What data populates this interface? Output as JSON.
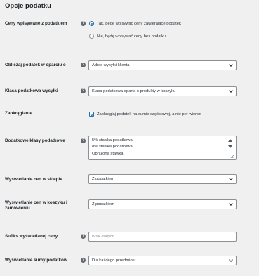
{
  "page": {
    "title": "Opcje podatku"
  },
  "prices_entered": {
    "label": "Ceny wpisywane z podatkiem",
    "options": [
      {
        "label": "Tak, będę wpisywać ceny zawierające podatek",
        "selected": true
      },
      {
        "label": "Nie, będę wpisywać ceny bez podatku",
        "selected": false
      }
    ]
  },
  "tax_based_on": {
    "label": "Obliczaj podatek w oparciu o",
    "value": "Adres wysyłki klienta"
  },
  "shipping_tax_class": {
    "label": "Klasa podatkowa wysyłki",
    "value": "Klasa podatkowa oparta o produkty w koszyku"
  },
  "rounding": {
    "label": "Zaokrąglanie",
    "checkbox_label": "Zaokrąglaj podatek na sumie częściowej, a nie per wiersz",
    "checked": true
  },
  "additional_tax_classes": {
    "label": "Dodatkowe klasy podatkowe",
    "items": [
      "5% stawka podatkowa",
      "8% stawka podatkowa",
      "Obniżona stawka"
    ]
  },
  "display_shop": {
    "label": "Wyświetlanie cen w sklepie",
    "value": "Z podatkiem"
  },
  "display_cart": {
    "label": "Wyświetlanie cen w koszyku i zamówieniu",
    "value": "Z podatkiem"
  },
  "price_suffix": {
    "label": "Sufiks wyświetlanej ceny",
    "placeholder": "Brak danych"
  },
  "display_totals": {
    "label": "Wyświetlanie sumy podatków",
    "value": "Dla każdego przedmiotu"
  },
  "colors": {
    "accent": "#2271b1",
    "background": "#f0f0f1",
    "help_icon": "#646970"
  },
  "icons": {
    "help": "help-icon",
    "chevron": "chevron-down-icon"
  }
}
